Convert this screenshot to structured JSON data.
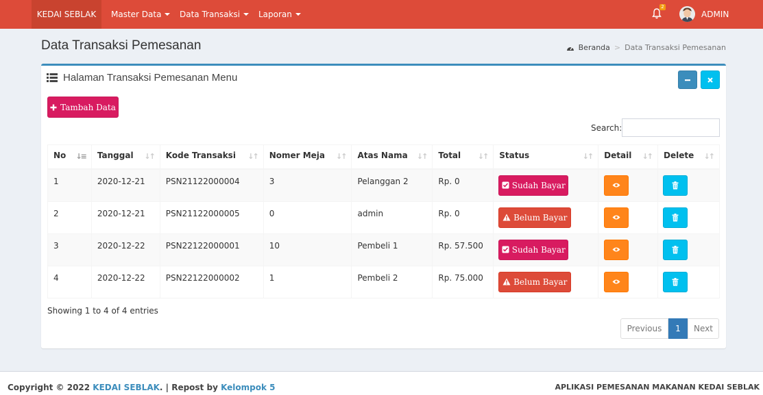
{
  "navbar": {
    "brand": "KEDAI SEBLAK",
    "menu": [
      {
        "label": "Master Data"
      },
      {
        "label": "Data Transaksi"
      },
      {
        "label": "Laporan"
      }
    ],
    "notification_count": "2",
    "user": "ADMIN",
    "color": "#dd4b39"
  },
  "header": {
    "title": "Data Transaksi Pemesanan",
    "breadcrumb": {
      "home": "Beranda",
      "sep": ">",
      "current": "Data Transaksi Pemesanan"
    }
  },
  "box": {
    "title": "Halaman Transaksi Pemesanan Menu",
    "add_button": "Tambah Data",
    "search_label": "Search:",
    "search_value": ""
  },
  "table": {
    "columns": [
      "No",
      "Tanggal",
      "Kode Transaksi",
      "Nomer Meja",
      "Atas Nama",
      "Total",
      "Status",
      "Detail",
      "Delete"
    ],
    "rows": [
      {
        "no": "1",
        "tanggal": "2020-12-21",
        "kode": "PSN21122000004",
        "meja": "3",
        "nama": "Pelanggan 2",
        "total": "Rp. 0",
        "status": "Sudah Bayar"
      },
      {
        "no": "2",
        "tanggal": "2020-12-21",
        "kode": "PSN21122000005",
        "meja": "0",
        "nama": "admin",
        "total": "Rp. 0",
        "status": "Belum Bayar"
      },
      {
        "no": "3",
        "tanggal": "2020-12-22",
        "kode": "PSN22122000001",
        "meja": "10",
        "nama": "Pembeli 1",
        "total": "Rp. 57.500",
        "status": "Sudah Bayar"
      },
      {
        "no": "4",
        "tanggal": "2020-12-22",
        "kode": "PSN22122000002",
        "meja": "1",
        "nama": "Pembeli 2",
        "total": "Rp. 75.000",
        "status": "Belum Bayar"
      }
    ]
  },
  "pagination": {
    "info": "Showing 1 to 4 of 4 entries",
    "previous": "Previous",
    "current": "1",
    "next": "Next"
  },
  "footer": {
    "copyright_prefix": "Copyright © 2022 ",
    "brand_link": "KEDAI SEBLAK",
    "middle": ". | Repost by ",
    "team_link": "Kelompok 5",
    "right": "APLIKASI PEMESANAN MAKANAN KEDAI SEBLAK"
  },
  "colors": {
    "primary": "#3c8dbc",
    "paid": "#d81b60",
    "unpaid": "#dd4b39",
    "detail": "#ff851b",
    "delete": "#00c0ef"
  }
}
